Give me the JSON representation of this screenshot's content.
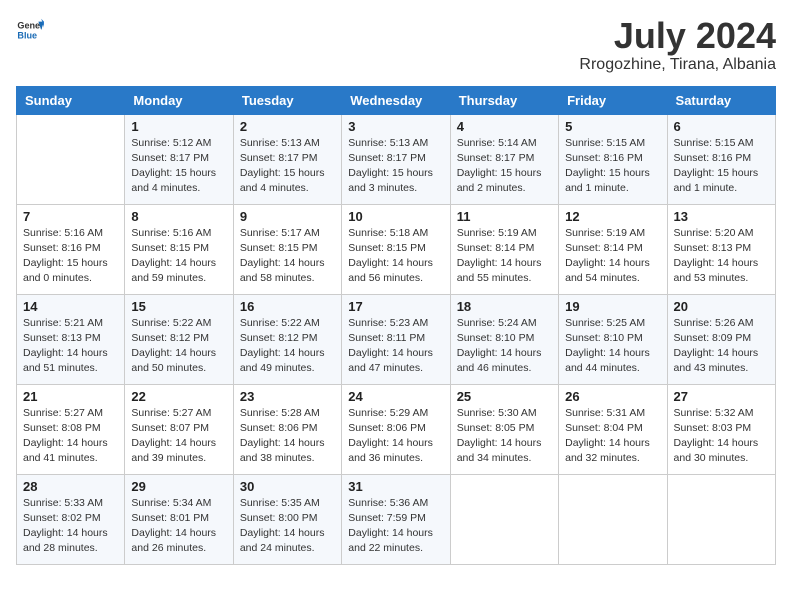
{
  "header": {
    "logo_line1": "General",
    "logo_line2": "Blue",
    "month": "July 2024",
    "location": "Rrogozhine, Tirana, Albania"
  },
  "days_of_week": [
    "Sunday",
    "Monday",
    "Tuesday",
    "Wednesday",
    "Thursday",
    "Friday",
    "Saturday"
  ],
  "weeks": [
    [
      {
        "day": "",
        "info": ""
      },
      {
        "day": "1",
        "info": "Sunrise: 5:12 AM\nSunset: 8:17 PM\nDaylight: 15 hours\nand 4 minutes."
      },
      {
        "day": "2",
        "info": "Sunrise: 5:13 AM\nSunset: 8:17 PM\nDaylight: 15 hours\nand 4 minutes."
      },
      {
        "day": "3",
        "info": "Sunrise: 5:13 AM\nSunset: 8:17 PM\nDaylight: 15 hours\nand 3 minutes."
      },
      {
        "day": "4",
        "info": "Sunrise: 5:14 AM\nSunset: 8:17 PM\nDaylight: 15 hours\nand 2 minutes."
      },
      {
        "day": "5",
        "info": "Sunrise: 5:15 AM\nSunset: 8:16 PM\nDaylight: 15 hours\nand 1 minute."
      },
      {
        "day": "6",
        "info": "Sunrise: 5:15 AM\nSunset: 8:16 PM\nDaylight: 15 hours\nand 1 minute."
      }
    ],
    [
      {
        "day": "7",
        "info": "Sunrise: 5:16 AM\nSunset: 8:16 PM\nDaylight: 15 hours\nand 0 minutes."
      },
      {
        "day": "8",
        "info": "Sunrise: 5:16 AM\nSunset: 8:15 PM\nDaylight: 14 hours\nand 59 minutes."
      },
      {
        "day": "9",
        "info": "Sunrise: 5:17 AM\nSunset: 8:15 PM\nDaylight: 14 hours\nand 58 minutes."
      },
      {
        "day": "10",
        "info": "Sunrise: 5:18 AM\nSunset: 8:15 PM\nDaylight: 14 hours\nand 56 minutes."
      },
      {
        "day": "11",
        "info": "Sunrise: 5:19 AM\nSunset: 8:14 PM\nDaylight: 14 hours\nand 55 minutes."
      },
      {
        "day": "12",
        "info": "Sunrise: 5:19 AM\nSunset: 8:14 PM\nDaylight: 14 hours\nand 54 minutes."
      },
      {
        "day": "13",
        "info": "Sunrise: 5:20 AM\nSunset: 8:13 PM\nDaylight: 14 hours\nand 53 minutes."
      }
    ],
    [
      {
        "day": "14",
        "info": "Sunrise: 5:21 AM\nSunset: 8:13 PM\nDaylight: 14 hours\nand 51 minutes."
      },
      {
        "day": "15",
        "info": "Sunrise: 5:22 AM\nSunset: 8:12 PM\nDaylight: 14 hours\nand 50 minutes."
      },
      {
        "day": "16",
        "info": "Sunrise: 5:22 AM\nSunset: 8:12 PM\nDaylight: 14 hours\nand 49 minutes."
      },
      {
        "day": "17",
        "info": "Sunrise: 5:23 AM\nSunset: 8:11 PM\nDaylight: 14 hours\nand 47 minutes."
      },
      {
        "day": "18",
        "info": "Sunrise: 5:24 AM\nSunset: 8:10 PM\nDaylight: 14 hours\nand 46 minutes."
      },
      {
        "day": "19",
        "info": "Sunrise: 5:25 AM\nSunset: 8:10 PM\nDaylight: 14 hours\nand 44 minutes."
      },
      {
        "day": "20",
        "info": "Sunrise: 5:26 AM\nSunset: 8:09 PM\nDaylight: 14 hours\nand 43 minutes."
      }
    ],
    [
      {
        "day": "21",
        "info": "Sunrise: 5:27 AM\nSunset: 8:08 PM\nDaylight: 14 hours\nand 41 minutes."
      },
      {
        "day": "22",
        "info": "Sunrise: 5:27 AM\nSunset: 8:07 PM\nDaylight: 14 hours\nand 39 minutes."
      },
      {
        "day": "23",
        "info": "Sunrise: 5:28 AM\nSunset: 8:06 PM\nDaylight: 14 hours\nand 38 minutes."
      },
      {
        "day": "24",
        "info": "Sunrise: 5:29 AM\nSunset: 8:06 PM\nDaylight: 14 hours\nand 36 minutes."
      },
      {
        "day": "25",
        "info": "Sunrise: 5:30 AM\nSunset: 8:05 PM\nDaylight: 14 hours\nand 34 minutes."
      },
      {
        "day": "26",
        "info": "Sunrise: 5:31 AM\nSunset: 8:04 PM\nDaylight: 14 hours\nand 32 minutes."
      },
      {
        "day": "27",
        "info": "Sunrise: 5:32 AM\nSunset: 8:03 PM\nDaylight: 14 hours\nand 30 minutes."
      }
    ],
    [
      {
        "day": "28",
        "info": "Sunrise: 5:33 AM\nSunset: 8:02 PM\nDaylight: 14 hours\nand 28 minutes."
      },
      {
        "day": "29",
        "info": "Sunrise: 5:34 AM\nSunset: 8:01 PM\nDaylight: 14 hours\nand 26 minutes."
      },
      {
        "day": "30",
        "info": "Sunrise: 5:35 AM\nSunset: 8:00 PM\nDaylight: 14 hours\nand 24 minutes."
      },
      {
        "day": "31",
        "info": "Sunrise: 5:36 AM\nSunset: 7:59 PM\nDaylight: 14 hours\nand 22 minutes."
      },
      {
        "day": "",
        "info": ""
      },
      {
        "day": "",
        "info": ""
      },
      {
        "day": "",
        "info": ""
      }
    ]
  ]
}
